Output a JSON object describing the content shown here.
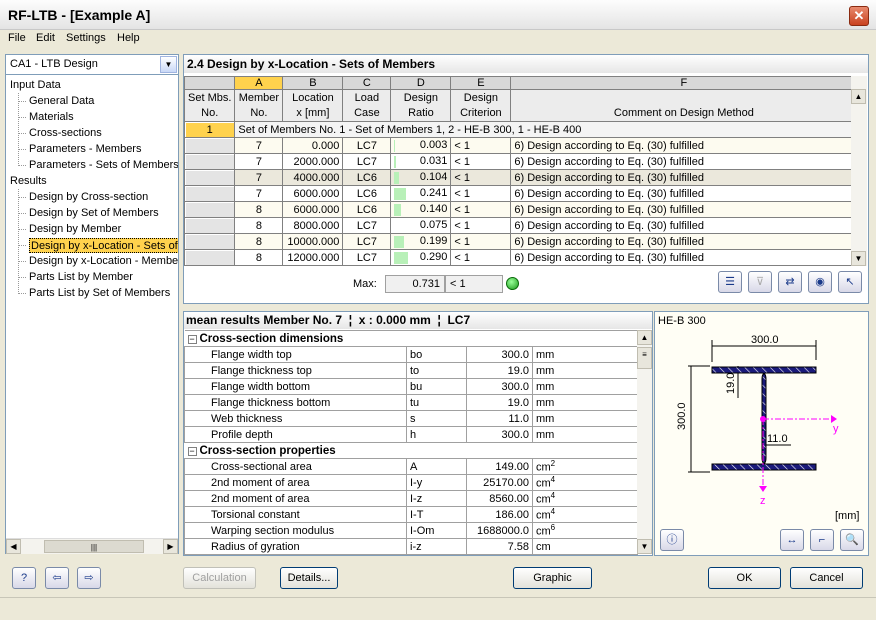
{
  "window": {
    "title": "RF-LTB - [Example A]",
    "close_icon": "close-icon"
  },
  "menu": [
    "File",
    "Edit",
    "Settings",
    "Help"
  ],
  "case_select": {
    "value": "CA1 - LTB Design"
  },
  "tree": {
    "groups": [
      {
        "label": "Input Data",
        "items": [
          "General Data",
          "Materials",
          "Cross-sections",
          "Parameters - Members",
          "Parameters - Sets of Members"
        ]
      },
      {
        "label": "Results",
        "items": [
          "Design by Cross-section",
          "Design by Set of Members",
          "Design by Member",
          "Design by x-Location - Sets of Members",
          "Design by x-Location - Members",
          "Parts List by Member",
          "Parts List by Set of Members"
        ]
      }
    ],
    "selected": "Design by x-Location - Sets of Members"
  },
  "section": {
    "title": "2.4 Design by x-Location - Sets of Members"
  },
  "grid": {
    "col_letters": [
      "A",
      "B",
      "C",
      "D",
      "E",
      "F"
    ],
    "headers": [
      "Set Mbs.\nNo.",
      "Member\nNo.",
      "Location\nx [mm]",
      "Load\nCase",
      "Design\nRatio",
      "Design\nCriterion",
      "Comment on Design Method"
    ],
    "set_row": {
      "no": "1",
      "label": "Set of Members No.  1 - Set of Members 1, 2 - HE-B 300, 1 - HE-B 400"
    },
    "rows": [
      {
        "member": "7",
        "x": "0.000",
        "lc": "LC7",
        "ratio": 0.003,
        "ratio_text": "0.003",
        "crit": "< 1",
        "comment": "6) Design according to Eq. (30) fulfilled"
      },
      {
        "member": "7",
        "x": "2000.000",
        "lc": "LC7",
        "ratio": 0.031,
        "ratio_text": "0.031",
        "crit": "< 1",
        "comment": "6) Design according to Eq. (30) fulfilled"
      },
      {
        "member": "7",
        "x": "4000.000",
        "lc": "LC6",
        "ratio": 0.104,
        "ratio_text": "0.104",
        "crit": "< 1",
        "comment": "6) Design according to Eq. (30) fulfilled"
      },
      {
        "member": "7",
        "x": "6000.000",
        "lc": "LC6",
        "ratio": 0.241,
        "ratio_text": "0.241",
        "crit": "< 1",
        "comment": "6) Design according to Eq. (30) fulfilled"
      },
      {
        "member": "8",
        "x": "6000.000",
        "lc": "LC6",
        "ratio": 0.14,
        "ratio_text": "0.140",
        "crit": "< 1",
        "comment": "6) Design according to Eq. (30) fulfilled"
      },
      {
        "member": "8",
        "x": "8000.000",
        "lc": "LC7",
        "ratio": 0.075,
        "ratio_text": "0.075",
        "crit": "< 1",
        "comment": "6) Design according to Eq. (30) fulfilled"
      },
      {
        "member": "8",
        "x": "10000.000",
        "lc": "LC7",
        "ratio": 0.199,
        "ratio_text": "0.199",
        "crit": "< 1",
        "comment": "6) Design according to Eq. (30) fulfilled"
      },
      {
        "member": "8",
        "x": "12000.000",
        "lc": "LC7",
        "ratio": 0.29,
        "ratio_text": "0.290",
        "crit": "< 1",
        "comment": "6) Design according to Eq. (30) fulfilled"
      }
    ],
    "max": {
      "label": "Max:",
      "value": "0.731",
      "crit": "< 1",
      "status": "ok"
    },
    "bar_color": "#b8f0b8"
  },
  "details": {
    "header": "mean results Member No. 7  ¦  x : 0.000 mm  ¦  LC7",
    "groups": [
      {
        "title": "Cross-section dimensions",
        "rows": [
          [
            "Flange width top",
            "bo",
            "300.0",
            "mm",
            ""
          ],
          [
            "Flange thickness top",
            "to",
            "19.0",
            "mm",
            ""
          ],
          [
            "Flange width bottom",
            "bu",
            "300.0",
            "mm",
            ""
          ],
          [
            "Flange thickness bottom",
            "tu",
            "19.0",
            "mm",
            ""
          ],
          [
            "Web thickness",
            "s",
            "11.0",
            "mm",
            ""
          ],
          [
            "Profile depth",
            "h",
            "300.0",
            "mm",
            ""
          ]
        ]
      },
      {
        "title": "Cross-section properties",
        "rows": [
          [
            "Cross-sectional area",
            "A",
            "149.00",
            "cm",
            "2"
          ],
          [
            "2nd moment of area",
            "I-y",
            "25170.00",
            "cm",
            "4"
          ],
          [
            "2nd moment of area",
            "I-z",
            "8560.00",
            "cm",
            "4"
          ],
          [
            "Torsional constant",
            "I-T",
            "186.00",
            "cm",
            "4"
          ],
          [
            "Warping section modulus",
            "I-Om",
            "1688000.0",
            "cm",
            "6"
          ],
          [
            "Radius of gyration",
            "i-z",
            "7.58",
            "cm",
            ""
          ]
        ]
      }
    ]
  },
  "graphic": {
    "section_name": "HE-B 300",
    "dim_width": "300.0",
    "dim_height": "300.0",
    "dim_flange": "19.0",
    "dim_web": "11.0",
    "axis_y": "y",
    "axis_z": "z",
    "unit": "[mm]",
    "profile_color": "#1a1a7a",
    "axis_color": "#ff00ff"
  },
  "buttons": {
    "calculation": "Calculation",
    "details": "Details...",
    "graphic": "Graphic",
    "ok": "OK",
    "cancel": "Cancel"
  }
}
